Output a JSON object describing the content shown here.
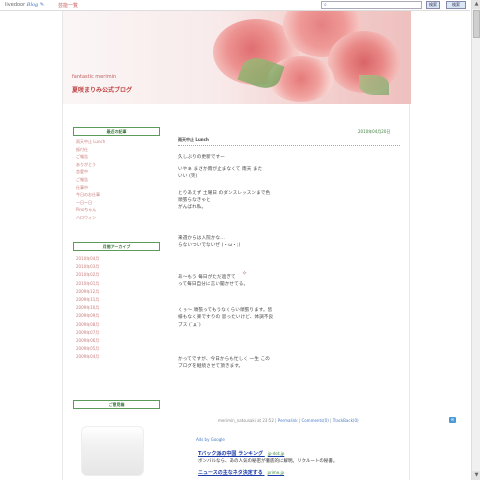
{
  "topbar": {
    "logo_text": "livedoor",
    "logo_blog": "Blog",
    "links": "芸能一覧",
    "search_btn": "検索",
    "search_btn2": "検索"
  },
  "header": {
    "subtitle": "fantastic merimin",
    "title": "夏咲まりみ公式ブログ"
  },
  "sidebar": {
    "recent_head": "最近の記事",
    "recent": [
      "雨天中止 Lunch",
      "振付仕",
      "ご報告",
      "ありがとう",
      "恋愛中",
      "ご報告",
      "仕事中",
      "今日のお仕事",
      "一日一日",
      "Pinoちゃん",
      "ハロウィン"
    ],
    "archive_head": "月間アーカイブ",
    "archives": [
      "2010年04月",
      "2010年03月",
      "2010年02月",
      "2010年01月",
      "2009年12月",
      "2009年11月",
      "2009年10月",
      "2009年09月",
      "2009年08月",
      "2009年07月",
      "2009年06月",
      "2009年05月",
      "2009年04月"
    ],
    "widget_head": "ご意見箱"
  },
  "entry": {
    "date": "2010年04月20日",
    "title": "雨天中止 Lunch",
    "lines": [
      "久しぶりの更新ですー",
      "いやぁ まさか雨が止まなくて 雨天 また",
      "いい (笑)",
      "とりあえず 土曜日 のダンスレッスンまで色",
      "頑張らなきゃと",
      "がんばれ私。",
      "来週からは入院かな...",
      "らないついでないぜ (・ω・;)",
      "あ〜もう 毎日がただ過ぎて",
      "って毎日自分に言い聞かせてる。",
      "くぅ〜 頑張ってもうなくらい頑張ります。皆",
      "様もなく楽ですりの 思ったいけど、体調不良",
      "ブス (`д´)",
      "かってですが、今日からも忙しく 一生 この",
      "ブログを継続させて頂きます。"
    ],
    "footer_author": "merimin_natsusaki at 23:52",
    "footer_permalink": "Permalink",
    "footer_comments": "Comments(0)",
    "footer_trackback": "TrackBack(0)"
  },
  "ads": {
    "label": "Ads by Google",
    "items": [
      {
        "title": "Tバック派の中国 ランキング",
        "url": "jp-dot.jp",
        "desc": "ボンバルなら、あの人気の秘密が徹底的に解明。リクルートの秘書。"
      },
      {
        "title": "ニュースの主なネタ決定する",
        "url": "prime.jp",
        "desc": ""
      }
    ]
  },
  "colors": {
    "accent_green": "#3a7a3a",
    "link_pink": "#c97a7a",
    "title_red": "#c04040"
  }
}
